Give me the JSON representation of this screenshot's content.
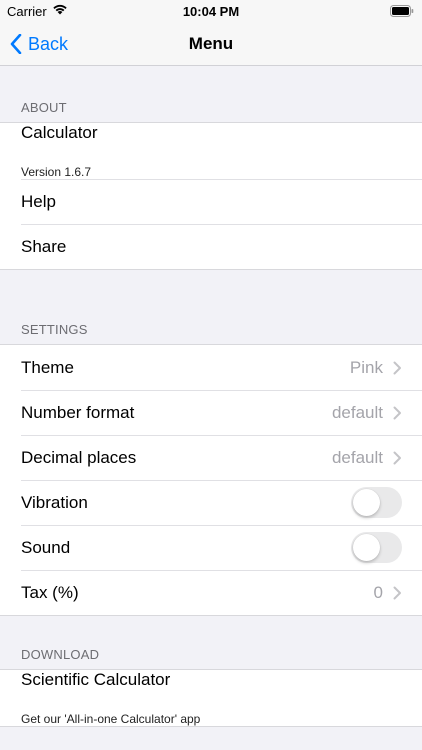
{
  "status_bar": {
    "carrier": "Carrier",
    "time": "10:04 PM"
  },
  "nav": {
    "back_label": "Back",
    "title": "Menu"
  },
  "about": {
    "header": "ABOUT",
    "app_name": "Calculator",
    "version": "Version 1.6.7",
    "help": "Help",
    "share": "Share"
  },
  "settings": {
    "header": "SETTINGS",
    "theme": {
      "label": "Theme",
      "value": "Pink"
    },
    "number_format": {
      "label": "Number format",
      "value": "default"
    },
    "decimal_places": {
      "label": "Decimal places",
      "value": "default"
    },
    "vibration": {
      "label": "Vibration",
      "on": false
    },
    "sound": {
      "label": "Sound",
      "on": false
    },
    "tax": {
      "label": "Tax (%)",
      "value": "0"
    }
  },
  "download": {
    "header": "DOWNLOAD",
    "title": "Scientific Calculator",
    "subtitle": "Get our 'All-in-one Calculator' app"
  },
  "colors": {
    "accent": "#007aff",
    "background": "#f2f2f7",
    "secondary_text": "#a4a4aa"
  }
}
